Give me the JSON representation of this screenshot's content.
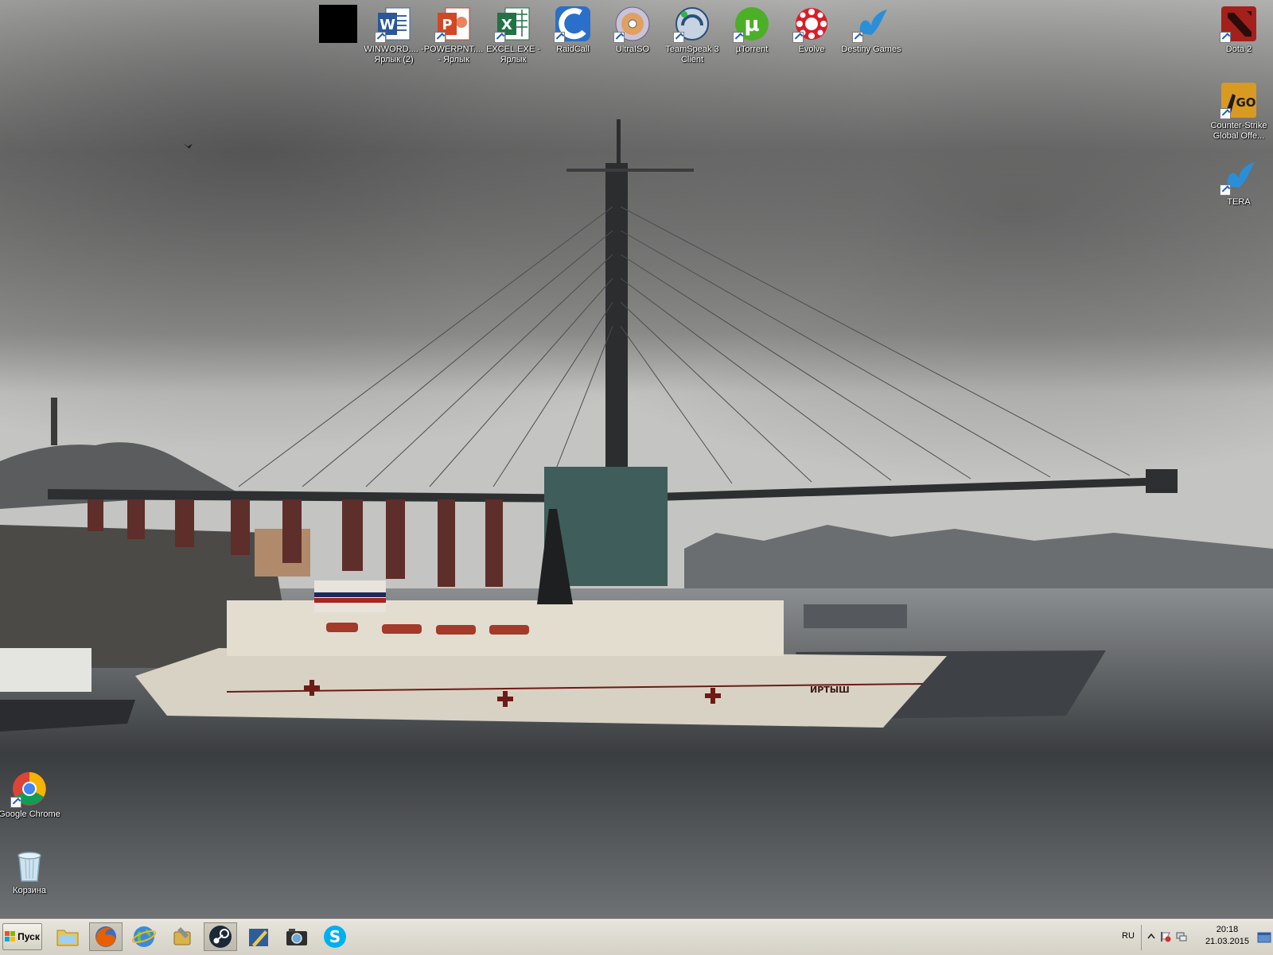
{
  "desktop": {
    "top_icons": [
      {
        "label": "",
        "icon": "black-square-icon"
      },
      {
        "label": "WINWORD.... - Ярлык (2)",
        "icon": "word-icon"
      },
      {
        "label": "POWERPNT.... - Ярлык",
        "icon": "powerpoint-icon"
      },
      {
        "label": "EXCEL.EXE - Ярлык",
        "icon": "excel-icon"
      },
      {
        "label": "RaidCall",
        "icon": "raidcall-icon"
      },
      {
        "label": "UltraISO",
        "icon": "ultraiso-icon"
      },
      {
        "label": "TeamSpeak 3 Client",
        "icon": "teamspeak-icon"
      },
      {
        "label": "µTorrent",
        "icon": "utorrent-icon"
      },
      {
        "label": "Evolve",
        "icon": "evolve-icon"
      },
      {
        "label": "Destiny Games",
        "icon": "destiny-games-icon"
      }
    ],
    "right_icons": [
      {
        "label": "Dota 2",
        "icon": "dota2-icon"
      },
      {
        "label": "Counter-Strike Global Offe...",
        "icon": "csgo-icon"
      },
      {
        "label": "TERA",
        "icon": "tera-icon"
      }
    ],
    "left_icons": [
      {
        "label": "Google Chrome",
        "icon": "chrome-icon"
      },
      {
        "label": "Корзина",
        "icon": "recycle-bin-icon"
      }
    ],
    "wallpaper": {
      "ship_name": "ИРТЫШ"
    }
  },
  "taskbar": {
    "start_label": "Пуск",
    "apps": [
      {
        "name": "explorer",
        "icon": "folder-icon"
      },
      {
        "name": "firefox",
        "icon": "firefox-icon"
      },
      {
        "name": "internet",
        "icon": "globe-icon"
      },
      {
        "name": "settings",
        "icon": "wrench-icon"
      },
      {
        "name": "steam",
        "icon": "steam-icon"
      },
      {
        "name": "editor",
        "icon": "pen-icon"
      },
      {
        "name": "camera",
        "icon": "camera-icon"
      },
      {
        "name": "skype",
        "icon": "skype-icon"
      }
    ],
    "language": "RU",
    "time": "20:18",
    "date": "21.03.2015"
  },
  "colors": {
    "taskbar": "#d9d5cb",
    "label_text": "#ffffff"
  }
}
